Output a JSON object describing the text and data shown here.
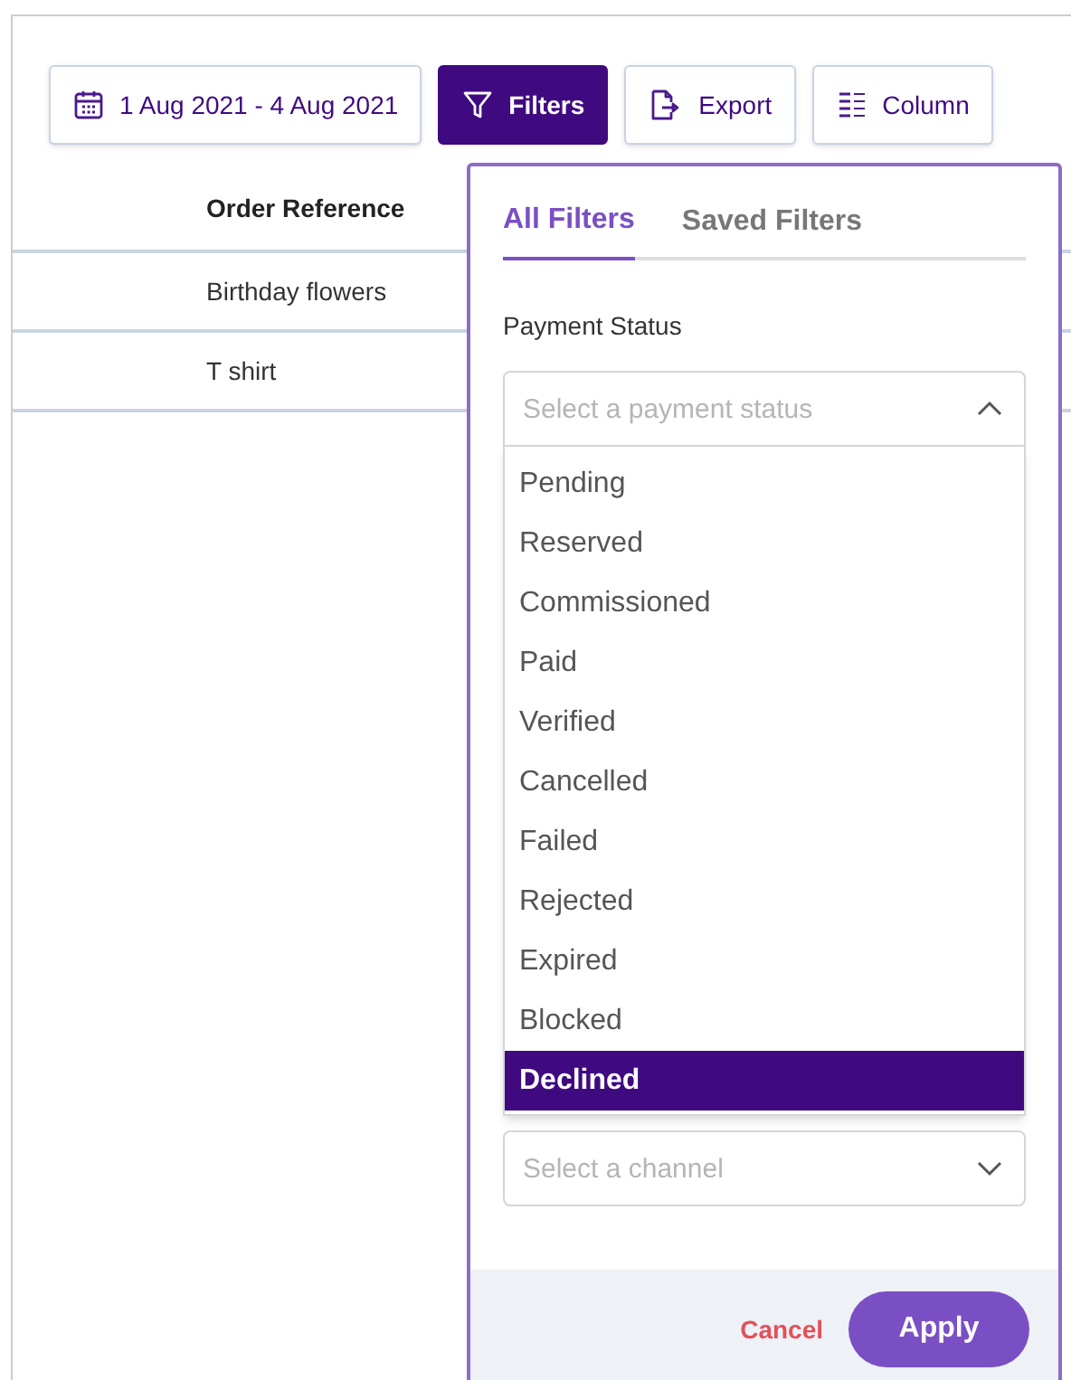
{
  "toolbar": {
    "buttons": [
      {
        "kind": "date",
        "label": "1 Aug 2021 - 4 Aug 2021",
        "selected": false
      },
      {
        "kind": "filter",
        "label": "Filters",
        "selected": true
      },
      {
        "kind": "export",
        "label": "Export",
        "selected": false
      },
      {
        "kind": "columns",
        "label": "Column",
        "selected": false
      }
    ]
  },
  "table": {
    "columns": [
      "Order Reference"
    ],
    "rows": [
      [
        "Birthday flowers"
      ],
      [
        "T shirt"
      ]
    ]
  },
  "filters_popover": {
    "tabs": [
      {
        "label": "All Filters",
        "selected": true
      },
      {
        "label": "Saved Filters",
        "selected": false
      }
    ],
    "payment_status": {
      "label": "Payment Status",
      "placeholder": "Select a payment status",
      "expanded": true,
      "options": [
        {
          "label": "Pending",
          "selected": false
        },
        {
          "label": "Reserved",
          "selected": false
        },
        {
          "label": "Commissioned",
          "selected": false
        },
        {
          "label": "Paid",
          "selected": false
        },
        {
          "label": "Verified",
          "selected": false
        },
        {
          "label": "Cancelled",
          "selected": false
        },
        {
          "label": "Failed",
          "selected": false
        },
        {
          "label": "Rejected",
          "selected": false
        },
        {
          "label": "Expired",
          "selected": false
        },
        {
          "label": "Blocked",
          "selected": false
        },
        {
          "label": "Declined",
          "selected": true
        }
      ]
    },
    "channel": {
      "placeholder": "Select a channel",
      "expanded": false
    },
    "cancel": "Cancel",
    "apply": "Apply"
  }
}
